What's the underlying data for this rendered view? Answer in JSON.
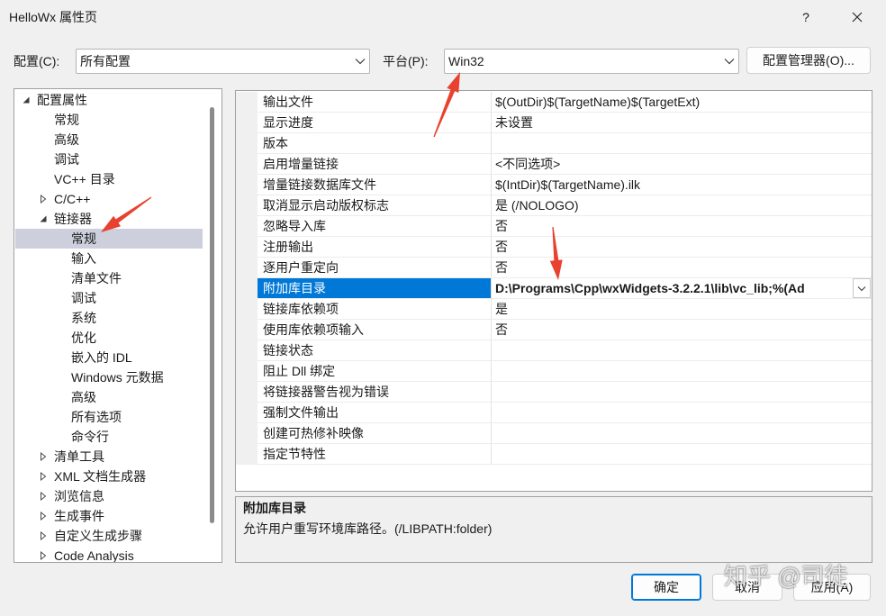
{
  "window": {
    "title": "HelloWx 属性页",
    "help_label": "?",
    "close_icon": "close-icon"
  },
  "toolbar": {
    "config_label": "配置(C):",
    "config_value": "所有配置",
    "platform_label": "平台(P):",
    "platform_value": "Win32",
    "config_manager_label": "配置管理器(O)...",
    "dropdown_icon": "chevron-down-icon"
  },
  "tree": {
    "scrollbar": {
      "position": 0,
      "visible_fraction": 0.92
    },
    "items": [
      {
        "label": "配置属性",
        "depth": 0,
        "expander_icon": "expanded-triangle-icon"
      },
      {
        "label": "常规",
        "depth": 1
      },
      {
        "label": "高级",
        "depth": 1
      },
      {
        "label": "调试",
        "depth": 1
      },
      {
        "label": "VC++ 目录",
        "depth": 1
      },
      {
        "label": "C/C++",
        "depth": 1,
        "expander_icon": "collapsed-triangle-icon"
      },
      {
        "label": "链接器",
        "depth": 1,
        "expander_icon": "expanded-triangle-icon"
      },
      {
        "label": "常规",
        "depth": 2,
        "selected": true
      },
      {
        "label": "输入",
        "depth": 2
      },
      {
        "label": "清单文件",
        "depth": 2
      },
      {
        "label": "调试",
        "depth": 2
      },
      {
        "label": "系统",
        "depth": 2
      },
      {
        "label": "优化",
        "depth": 2
      },
      {
        "label": "嵌入的 IDL",
        "depth": 2
      },
      {
        "label": "Windows 元数据",
        "depth": 2
      },
      {
        "label": "高级",
        "depth": 2
      },
      {
        "label": "所有选项",
        "depth": 2
      },
      {
        "label": "命令行",
        "depth": 2
      },
      {
        "label": "清单工具",
        "depth": 1,
        "expander_icon": "collapsed-triangle-icon"
      },
      {
        "label": "XML 文档生成器",
        "depth": 1,
        "expander_icon": "collapsed-triangle-icon"
      },
      {
        "label": "浏览信息",
        "depth": 1,
        "expander_icon": "collapsed-triangle-icon"
      },
      {
        "label": "生成事件",
        "depth": 1,
        "expander_icon": "collapsed-triangle-icon"
      },
      {
        "label": "自定义生成步骤",
        "depth": 1,
        "expander_icon": "collapsed-triangle-icon"
      },
      {
        "label": "Code Analysis",
        "depth": 1,
        "expander_icon": "collapsed-triangle-icon"
      }
    ]
  },
  "properties": {
    "rows": [
      {
        "name": "输出文件",
        "value": "$(OutDir)$(TargetName)$(TargetExt)"
      },
      {
        "name": "显示进度",
        "value": "未设置"
      },
      {
        "name": "版本",
        "value": ""
      },
      {
        "name": "启用增量链接",
        "value": "<不同选项>"
      },
      {
        "name": "增量链接数据库文件",
        "value": "$(IntDir)$(TargetName).ilk"
      },
      {
        "name": "取消显示启动版权标志",
        "value": "是 (/NOLOGO)"
      },
      {
        "name": "忽略导入库",
        "value": "否"
      },
      {
        "name": "注册输出",
        "value": "否"
      },
      {
        "name": "逐用户重定向",
        "value": "否"
      },
      {
        "name": "附加库目录",
        "value": "D:\\Programs\\Cpp\\wxWidgets-3.2.2.1\\lib\\vc_lib;%(Ad",
        "selected": true,
        "modified": true,
        "dropdown": true
      },
      {
        "name": "链接库依赖项",
        "value": "是"
      },
      {
        "name": "使用库依赖项输入",
        "value": "否"
      },
      {
        "name": "链接状态",
        "value": ""
      },
      {
        "name": "阻止 Dll 绑定",
        "value": ""
      },
      {
        "name": "将链接器警告视为错误",
        "value": ""
      },
      {
        "name": "强制文件输出",
        "value": ""
      },
      {
        "name": "创建可热修补映像",
        "value": ""
      },
      {
        "name": "指定节特性",
        "value": ""
      }
    ]
  },
  "description": {
    "title": "附加库目录",
    "text": "允许用户重写环境库路径。(/LIBPATH:folder)"
  },
  "buttons": {
    "ok": "确定",
    "cancel": "取消",
    "apply": "应用(A)"
  },
  "watermark": "知乎 @司徒",
  "colors": {
    "accent": "#0078d7",
    "tree_selection": "#cdd0dc",
    "annotation": "#e8412f",
    "window_bg": "#f0f0f0"
  }
}
